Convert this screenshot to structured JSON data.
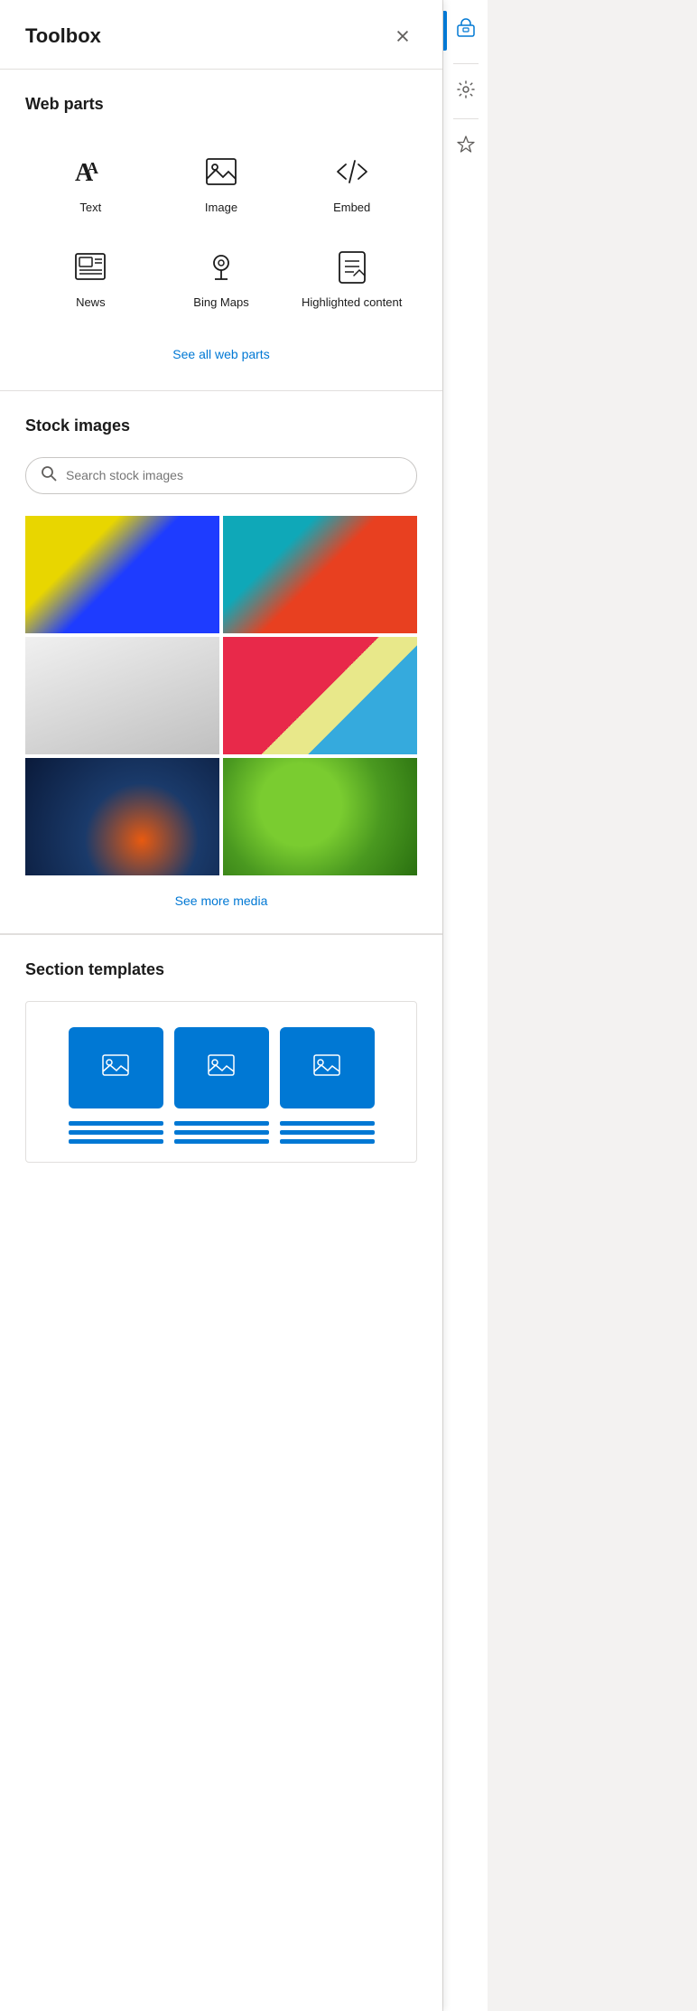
{
  "header": {
    "title": "Toolbox",
    "close_label": "×"
  },
  "webParts": {
    "section_title": "Web parts",
    "items": [
      {
        "id": "text",
        "label": "Text",
        "icon": "text-icon"
      },
      {
        "id": "image",
        "label": "Image",
        "icon": "image-icon"
      },
      {
        "id": "embed",
        "label": "Embed",
        "icon": "embed-icon"
      },
      {
        "id": "news",
        "label": "News",
        "icon": "news-icon"
      },
      {
        "id": "bing-maps",
        "label": "Bing Maps",
        "icon": "map-icon"
      },
      {
        "id": "highlighted-content",
        "label": "Highlighted content",
        "icon": "highlighted-content-icon"
      }
    ],
    "see_all_label": "See all web parts"
  },
  "stockImages": {
    "section_title": "Stock images",
    "search_placeholder": "Search stock images",
    "see_more_label": "See more media",
    "images": [
      {
        "id": "img-1",
        "alt": "Yellow and blue color powder"
      },
      {
        "id": "img-2",
        "alt": "Teal and orange color powder"
      },
      {
        "id": "img-3",
        "alt": "Gray fabric texture"
      },
      {
        "id": "img-4",
        "alt": "Colorful paper geometric shapes"
      },
      {
        "id": "img-5",
        "alt": "Dark blue bokeh background"
      },
      {
        "id": "img-6",
        "alt": "Green leaves blurred background"
      }
    ]
  },
  "sectionTemplates": {
    "section_title": "Section templates"
  },
  "sidebar": {
    "icons": [
      {
        "id": "toolbox",
        "icon": "toolbox-icon",
        "active": true
      },
      {
        "id": "settings",
        "icon": "settings-icon",
        "active": false
      },
      {
        "id": "ai",
        "icon": "ai-icon",
        "active": false
      }
    ]
  }
}
